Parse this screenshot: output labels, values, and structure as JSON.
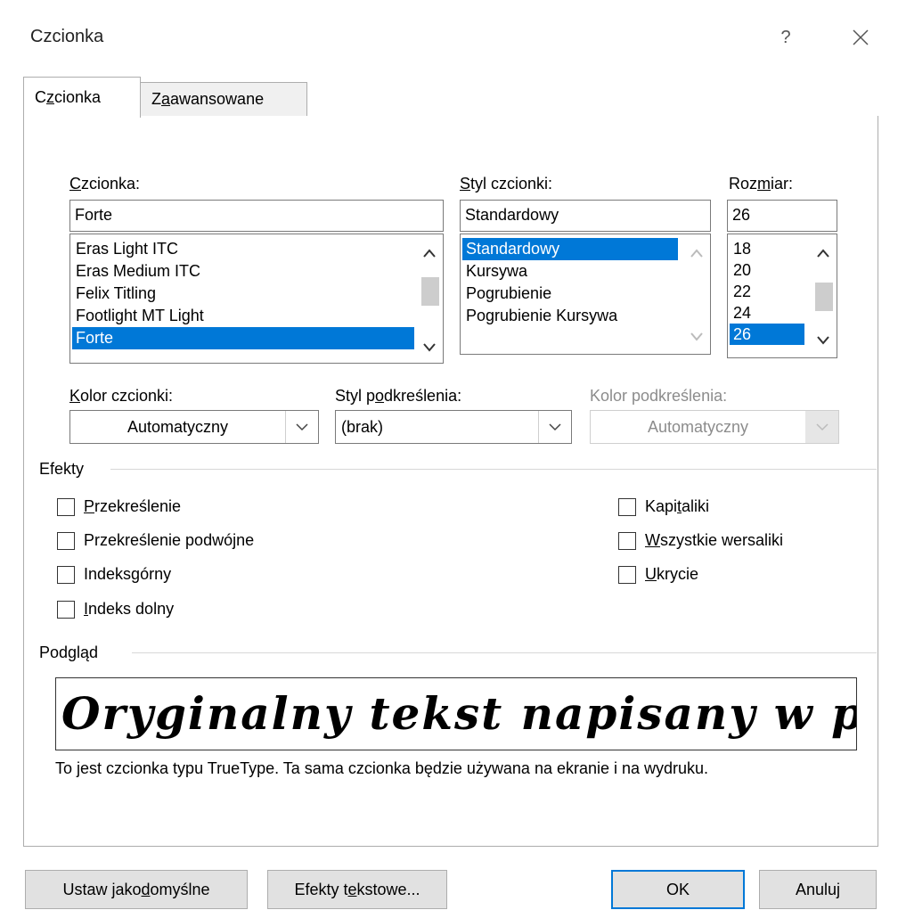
{
  "window": {
    "title": "Czcionka",
    "help_label": "?",
    "close_label": "✕"
  },
  "tabs": [
    {
      "pre": "C",
      "u": "z",
      "post": "cionka",
      "active": true
    },
    {
      "pre": "Z",
      "u": "a",
      "post": "awansowane",
      "active": false
    }
  ],
  "font_label": {
    "pre": "",
    "u": "C",
    "post": "zcionka:"
  },
  "font_input": {
    "value": "Forte"
  },
  "font_list": [
    "Eras Light ITC",
    "Eras Medium ITC",
    "Felix Titling",
    "Footlight MT Light",
    "Forte"
  ],
  "font_selected": "Forte",
  "style_label": {
    "pre": "",
    "u": "S",
    "post": "tyl czcionki:"
  },
  "style_input": {
    "value": "Standardowy"
  },
  "style_list": [
    "Standardowy",
    "Kursywa",
    "Pogrubienie",
    "Pogrubienie Kursywa"
  ],
  "style_selected": "Standardowy",
  "size_label": {
    "pre": "Roz",
    "u": "m",
    "post": "iar:"
  },
  "size_input": {
    "value": "26"
  },
  "size_list": [
    "18",
    "20",
    "22",
    "24",
    "26"
  ],
  "size_selected": "26",
  "font_color": {
    "label_pre": "",
    "label_u": "K",
    "label_post": "olor czcionki:",
    "value": "Automatyczny"
  },
  "underline_style": {
    "label_pre": "Styl p",
    "label_u": "o",
    "label_post": "dkreślenia:",
    "value": "(brak)"
  },
  "underline_color": {
    "label": "Kolor podkreślenia:",
    "value": "Automatyczny"
  },
  "effects": {
    "title": "Efekty",
    "left": [
      {
        "pre": "",
        "u": "P",
        "post": "rzekreślenie"
      },
      {
        "pre": "Przekreślenie podwó",
        "u": "j",
        "post": "ne"
      },
      {
        "pre": "Indeks ",
        "u": "g",
        "post": "órny"
      },
      {
        "pre": "",
        "u": "I",
        "post": "ndeks dolny"
      }
    ],
    "right": [
      {
        "pre": "Kapi",
        "u": "t",
        "post": "aliki"
      },
      {
        "pre": "",
        "u": "W",
        "post": "szystkie wersaliki"
      },
      {
        "pre": "",
        "u": "U",
        "post": "krycie"
      }
    ]
  },
  "preview": {
    "title": "Podgląd",
    "sample_text": "Oryginalny tekst napisany w pl",
    "description": "To jest czcionka typu TrueType. Ta sama czcionka będzie używana na ekranie i na wydruku."
  },
  "buttons": {
    "set_default": {
      "pre": "Ustaw jako ",
      "u": "d",
      "post": "omyślne"
    },
    "text_effects": {
      "pre": "Efekty t",
      "u": "e",
      "post": "kstowe..."
    },
    "ok": "OK",
    "cancel": "Anuluj"
  }
}
